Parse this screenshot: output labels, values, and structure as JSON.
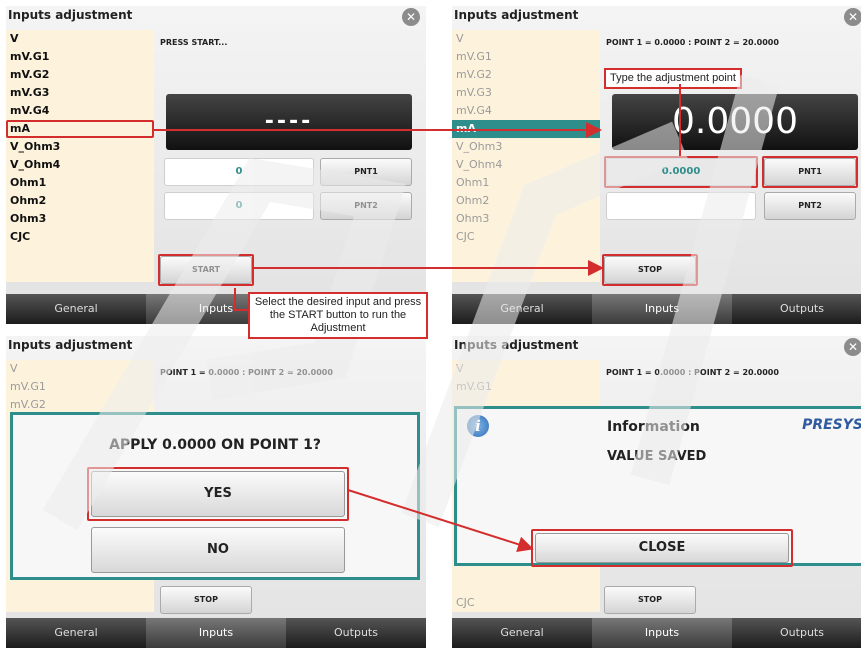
{
  "common": {
    "title": "Inputs adjustment",
    "close_glyph": "✕",
    "tabs": [
      "General",
      "Inputs",
      "Outputs"
    ]
  },
  "input_list": [
    "V",
    "mV.G1",
    "mV.G2",
    "mV.G3",
    "mV.G4",
    "mA",
    "V_Ohm3",
    "V_Ohm4",
    "Ohm1",
    "Ohm2",
    "Ohm3",
    "CJC"
  ],
  "panel1": {
    "info": "PRESS START...",
    "display": "----",
    "point1_value": "0",
    "point2_value": "0",
    "pnt1_label": "PNT1",
    "pnt2_label": "PNT2",
    "start_label": "START",
    "active_tab": "Inputs"
  },
  "panel2": {
    "info": "POINT 1 = 0.0000 : POINT 2 = 20.0000",
    "display": "0.0000",
    "point1_value": "0.0000",
    "pnt1_label": "PNT1",
    "pnt2_label": "PNT2",
    "stop_label": "STOP",
    "selected_item": "mA",
    "active_tab": "Inputs"
  },
  "panel3": {
    "info": "POINT 1 = 0.0000 : POINT 2 = 20.0000",
    "question": "APPLY 0.0000 ON POINT 1?",
    "yes_label": "YES",
    "no_label": "NO",
    "stop_label": "STOP",
    "active_tab": "Inputs"
  },
  "panel4": {
    "info": "POINT 1 = 0.0000 : POINT 2 = 20.0000",
    "dialog_title": "Information",
    "brand": "PRESYS",
    "message": "VALUE SAVED",
    "close_label": "CLOSE",
    "stop_label": "STOP",
    "active_tab": "Inputs"
  },
  "annotations": {
    "type_point": "Type the adjustment point",
    "select_input": "Select the desired input and press the START button to run the Adjustment"
  },
  "colors": {
    "accent_teal": "#2e8e8c",
    "annotation_red": "#d42d2d",
    "list_bg": "#fdf3dc"
  }
}
